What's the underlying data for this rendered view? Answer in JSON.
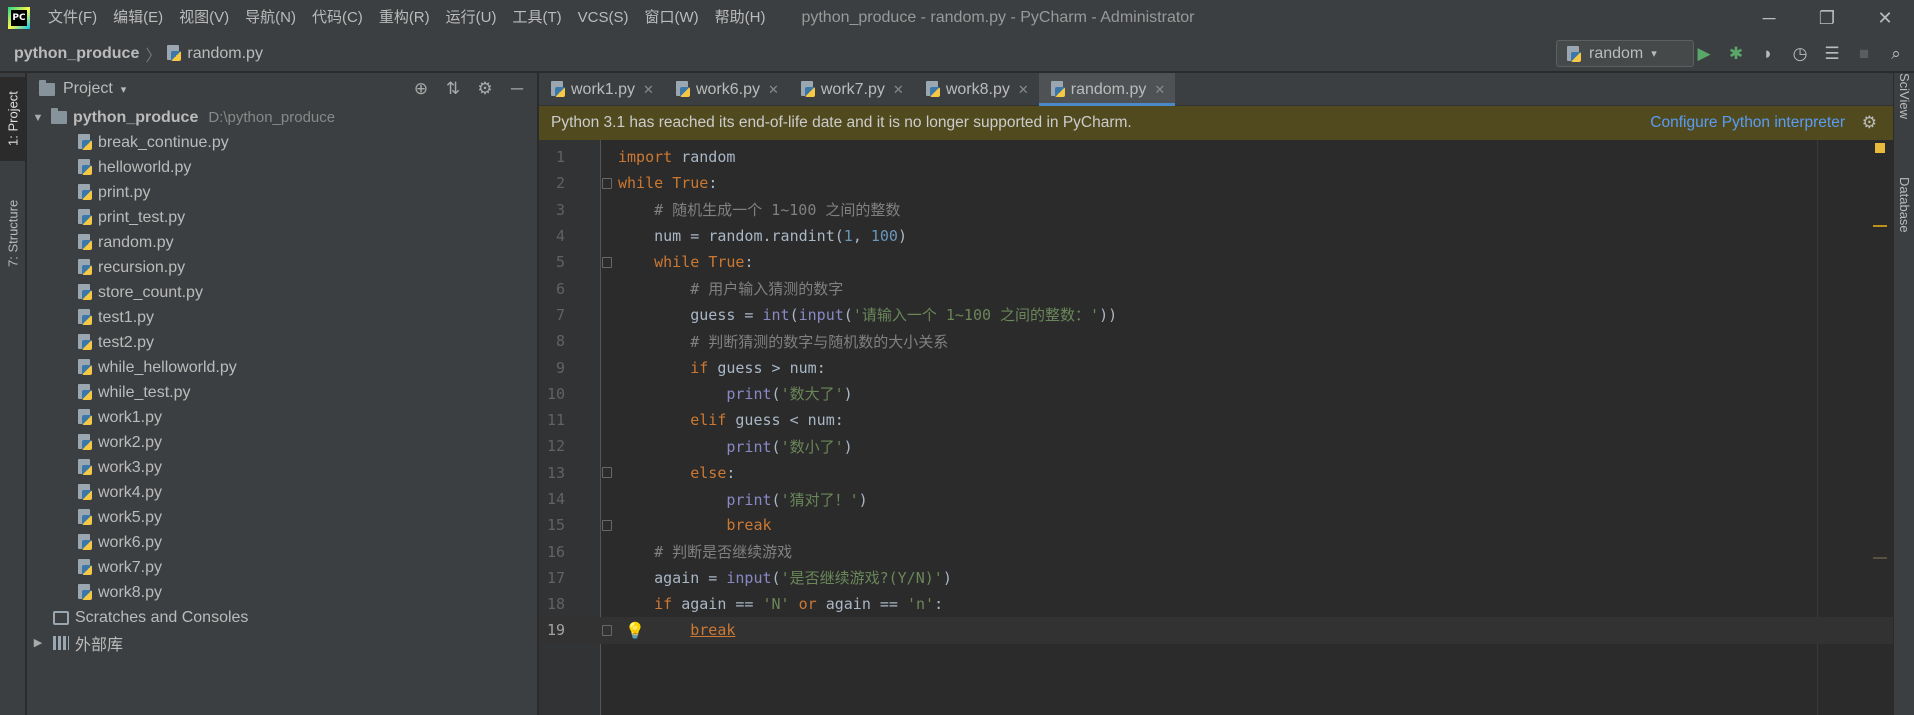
{
  "window": {
    "title": "python_produce - random.py - PyCharm - Administrator",
    "controls": {
      "minimize": "─",
      "restore": "❐",
      "close": "✕"
    }
  },
  "menu": [
    "文件(F)",
    "编辑(E)",
    "视图(V)",
    "导航(N)",
    "代码(C)",
    "重构(R)",
    "运行(U)",
    "工具(T)",
    "VCS(S)",
    "窗口(W)",
    "帮助(H)"
  ],
  "breadcrumb": {
    "project": "python_produce",
    "separator": "〉",
    "file": "random.py"
  },
  "run_config": {
    "label": "random",
    "caret": "▾"
  },
  "toolbar_icons": [
    "run-icon",
    "debug-icon",
    "coverage-icon",
    "profile-icon",
    "concurrency-icon",
    "stop-icon",
    "search-icon"
  ],
  "toolbar_glyphs": {
    "run": "▶",
    "debug": "✱",
    "coverage": "◗",
    "profile": "◷",
    "concurrency": "☰",
    "stop": "■",
    "search": "⌕"
  },
  "left_strip": {
    "project_tab": "1: Project",
    "structure_tab": "7: Structure"
  },
  "right_strip": {
    "sciview": "SciView",
    "database": "Database"
  },
  "project_panel": {
    "title": "Project",
    "caret": "▾",
    "tools": {
      "locate": "⊕",
      "collapse": "⇅",
      "settings": "⚙",
      "hide": "─"
    },
    "root": {
      "name": "python_produce",
      "path": "D:\\python_produce",
      "arrow": "▼"
    },
    "files": [
      "break_continue.py",
      "helloworld.py",
      "print.py",
      "print_test.py",
      "random.py",
      "recursion.py",
      "store_count.py",
      "test1.py",
      "test2.py",
      "while_helloworld.py",
      "while_test.py",
      "work1.py",
      "work2.py",
      "work3.py",
      "work4.py",
      "work5.py",
      "work6.py",
      "work7.py",
      "work8.py"
    ],
    "scratches": "Scratches and Consoles",
    "external_libs": {
      "name": "外部库",
      "arrow": "▶"
    }
  },
  "tabs": [
    {
      "label": "work1.py",
      "active": false
    },
    {
      "label": "work6.py",
      "active": false
    },
    {
      "label": "work7.py",
      "active": false
    },
    {
      "label": "work8.py",
      "active": false
    },
    {
      "label": "random.py",
      "active": true
    }
  ],
  "tab_close": "✕",
  "banner": {
    "message": "Python 3.1 has reached its end-of-life date and it is no longer supported in PyCharm.",
    "link": "Configure Python interpreter",
    "gear": "⚙"
  },
  "code_lines": [
    {
      "n": "1",
      "text": "import random"
    },
    {
      "n": "2",
      "text": "while True:"
    },
    {
      "n": "3",
      "text": "    # 随机生成一个 1~100 之间的整数"
    },
    {
      "n": "4",
      "text": "    num = random.randint(1, 100)"
    },
    {
      "n": "5",
      "text": "    while True:"
    },
    {
      "n": "6",
      "text": "        # 用户输入猜测的数字"
    },
    {
      "n": "7",
      "text": "        guess = int(input('请输入一个 1~100 之间的整数：'))"
    },
    {
      "n": "8",
      "text": "        # 判断猜测的数字与随机数的大小关系"
    },
    {
      "n": "9",
      "text": "        if guess > num:"
    },
    {
      "n": "10",
      "text": "            print('数大了')"
    },
    {
      "n": "11",
      "text": "        elif guess < num:"
    },
    {
      "n": "12",
      "text": "            print('数小了')"
    },
    {
      "n": "13",
      "text": "        else:"
    },
    {
      "n": "14",
      "text": "            print('猜对了！')"
    },
    {
      "n": "15",
      "text": "            break"
    },
    {
      "n": "16",
      "text": "    # 判断是否继续游戏"
    },
    {
      "n": "17",
      "text": "    again = input('是否继续游戏?(Y/N)')"
    },
    {
      "n": "18",
      "text": "    if again == 'N' or again == 'n':"
    },
    {
      "n": "19",
      "text": "        break"
    }
  ],
  "current_line": "19",
  "colors": {
    "keyword": "#cc7832",
    "comment": "#808080",
    "string": "#6a8759",
    "number": "#6897bb",
    "builtin": "#8888c6",
    "accent": "#4a88c7",
    "banner_bg": "#514a1f",
    "link": "#589df6"
  }
}
